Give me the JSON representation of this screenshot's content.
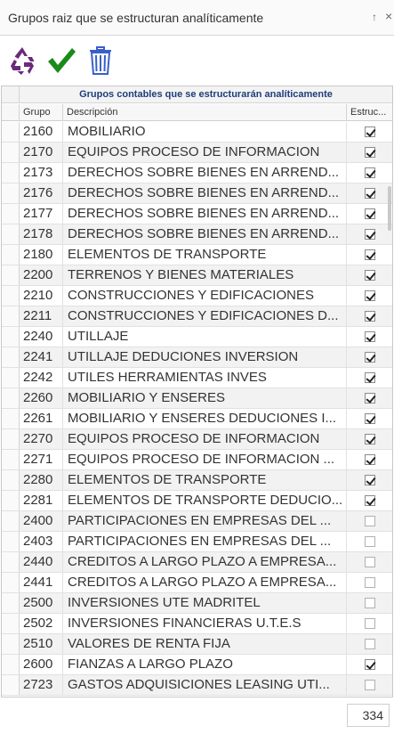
{
  "panel": {
    "title": "Grupos raiz que se estructuran analíticamente",
    "pin_glyph": "↑",
    "close_glyph": "×"
  },
  "toolbar": {
    "icons": [
      "recycle-icon",
      "checkmark-icon",
      "trash-icon"
    ]
  },
  "grid": {
    "caption": "Grupos contables que se estructurarán analíticamente",
    "columns": {
      "code": "Grupo",
      "description": "Descripción",
      "flag": "Estruc..."
    },
    "rows": [
      {
        "code": "2160",
        "description": "MOBILIARIO",
        "checked": true
      },
      {
        "code": "2170",
        "description": "EQUIPOS PROCESO DE INFORMACION",
        "checked": true
      },
      {
        "code": "2173",
        "description": "DERECHOS SOBRE BIENES EN ARREND...",
        "checked": true
      },
      {
        "code": "2176",
        "description": "DERECHOS SOBRE BIENES EN ARREND...",
        "checked": true
      },
      {
        "code": "2177",
        "description": "DERECHOS SOBRE BIENES EN ARREND...",
        "checked": true
      },
      {
        "code": "2178",
        "description": "DERECHOS SOBRE BIENES EN ARREND...",
        "checked": true
      },
      {
        "code": "2180",
        "description": "ELEMENTOS DE TRANSPORTE",
        "checked": true
      },
      {
        "code": "2200",
        "description": "TERRENOS Y BIENES MATERIALES",
        "checked": true
      },
      {
        "code": "2210",
        "description": "CONSTRUCCIONES Y EDIFICACIONES",
        "checked": true
      },
      {
        "code": "2211",
        "description": "CONSTRUCCIONES Y EDIFICACIONES D...",
        "checked": true
      },
      {
        "code": "2240",
        "description": "UTILLAJE",
        "checked": true
      },
      {
        "code": "2241",
        "description": "UTILLAJE DEDUCIONES INVERSION",
        "checked": true
      },
      {
        "code": "2242",
        "description": "UTILES HERRAMIENTAS INVES",
        "checked": true
      },
      {
        "code": "2260",
        "description": "MOBILIARIO Y ENSERES",
        "checked": true
      },
      {
        "code": "2261",
        "description": "MOBILIARIO Y ENSERES DEDUCIONES I...",
        "checked": true
      },
      {
        "code": "2270",
        "description": "EQUIPOS PROCESO DE INFORMACION",
        "checked": true
      },
      {
        "code": "2271",
        "description": "EQUIPOS PROCESO DE INFORMACION ...",
        "checked": true
      },
      {
        "code": "2280",
        "description": "ELEMENTOS DE TRANSPORTE",
        "checked": true
      },
      {
        "code": "2281",
        "description": "ELEMENTOS DE TRANSPORTE DEDUCIO...",
        "checked": true
      },
      {
        "code": "2400",
        "description": "PARTICIPACIONES EN EMPRESAS DEL ...",
        "checked": false
      },
      {
        "code": "2403",
        "description": "PARTICIPACIONES EN EMPRESAS DEL ...",
        "checked": false
      },
      {
        "code": "2440",
        "description": "CREDITOS A LARGO PLAZO A EMPRESA...",
        "checked": false
      },
      {
        "code": "2441",
        "description": "CREDITOS A LARGO PLAZO A EMPRESA...",
        "checked": false
      },
      {
        "code": "2500",
        "description": "INVERSIONES UTE MADRITEL",
        "checked": false
      },
      {
        "code": "2502",
        "description": "INVERSIONES FINANCIERAS U.T.E.S",
        "checked": false
      },
      {
        "code": "2510",
        "description": "VALORES DE RENTA FIJA",
        "checked": false
      },
      {
        "code": "2600",
        "description": "FIANZAS A LARGO PLAZO",
        "checked": true
      },
      {
        "code": "2723",
        "description": "GASTOS ADQUISICIONES LEASING UTI...",
        "checked": false
      }
    ]
  },
  "footer": {
    "count": "334"
  },
  "colors": {
    "caption_text": "#1f3d7a",
    "recycle": "#6a2a7a",
    "check": "#1a8a1a",
    "trash": "#3a5fc8"
  }
}
